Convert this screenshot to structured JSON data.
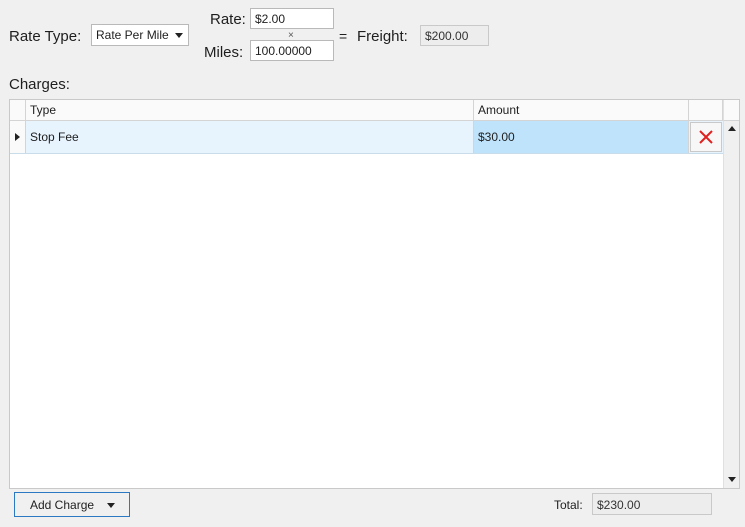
{
  "rate_section": {
    "rate_type_label": "Rate Type:",
    "rate_type_value": "Rate Per Mile",
    "rate_label": "Rate:",
    "rate_value": "$2.00",
    "times_sign": "×",
    "miles_label": "Miles:",
    "miles_value": "100.00000",
    "equals_sign": "=",
    "freight_label": "Freight:",
    "freight_value": "$200.00"
  },
  "charges": {
    "label": "Charges:",
    "columns": {
      "type": "Type",
      "amount": "Amount"
    },
    "rows": [
      {
        "type": "Stop Fee",
        "amount": "$30.00"
      }
    ]
  },
  "footer": {
    "add_charge_label": "Add Charge",
    "total_label": "Total:",
    "total_value": "$230.00"
  },
  "colors": {
    "delete_icon": "#e02020",
    "selected_cell": "#bfe3fb",
    "row_highlight": "#e7f3fd",
    "button_border": "#2b79c2"
  },
  "icons": [
    "dropdown-caret-icon",
    "row-indicator-icon",
    "delete-x-icon",
    "scroll-up-icon",
    "scroll-down-icon"
  ]
}
